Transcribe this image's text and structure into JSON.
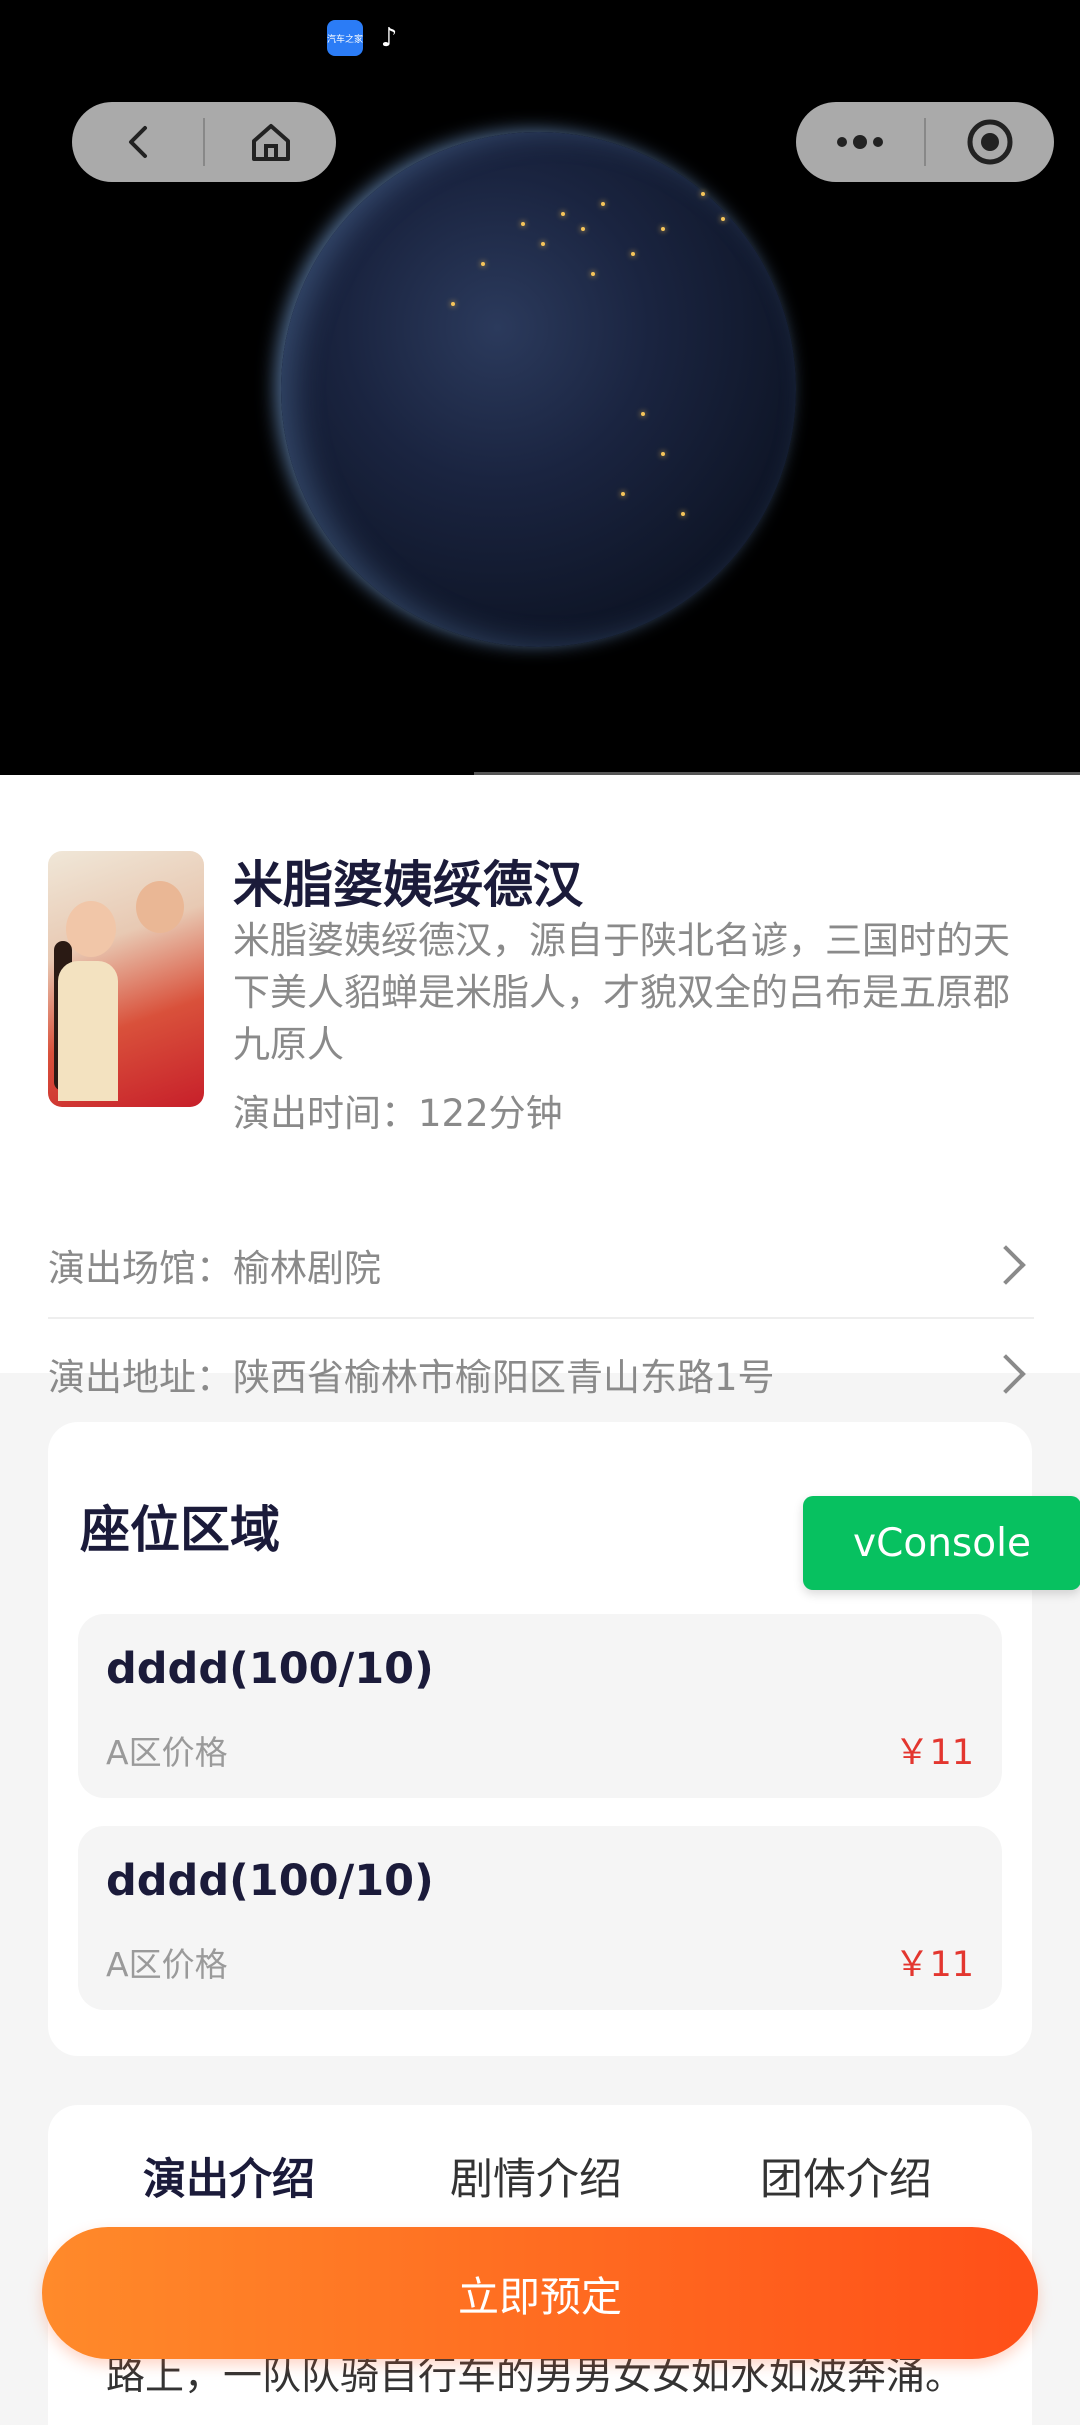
{
  "status_bar": {
    "app_icon_label": "汽车之家"
  },
  "show": {
    "title": "米脂婆姨绥德汉",
    "description": "米脂婆姨绥德汉，源自于陕北名谚，三国时的天下美人貂蝉是米脂人，才貌双全的吕布是五原郡九原人",
    "duration": "演出时间：122分钟",
    "venue": "演出场馆：榆林剧院",
    "address": "演出地址：陕西省榆林市榆阳区青山东路1号"
  },
  "seats": {
    "title": "座位区域",
    "items": [
      {
        "name": "dddd(100/10)",
        "area": "A区价格",
        "price": "￥11"
      },
      {
        "name": "dddd(100/10)",
        "area": "A区价格",
        "price": "￥11"
      }
    ]
  },
  "vconsole_label": "vConsole",
  "tabs": [
    {
      "label": "演出介绍"
    },
    {
      "label": "剧情介绍"
    },
    {
      "label": "团体介绍"
    }
  ],
  "intro_text_partial": "路上，一队队骑自行车的男男女女如水如波奔涌。",
  "book_button": "立即预定",
  "icons": {
    "back": "back-icon",
    "home": "home-icon",
    "more": "more-icon",
    "close": "target-icon"
  },
  "colors": {
    "accent_orange_start": "#ff8a2a",
    "accent_orange_end": "#ff4f18",
    "price_red": "#e3362f",
    "vconsole_green": "#07c160"
  }
}
